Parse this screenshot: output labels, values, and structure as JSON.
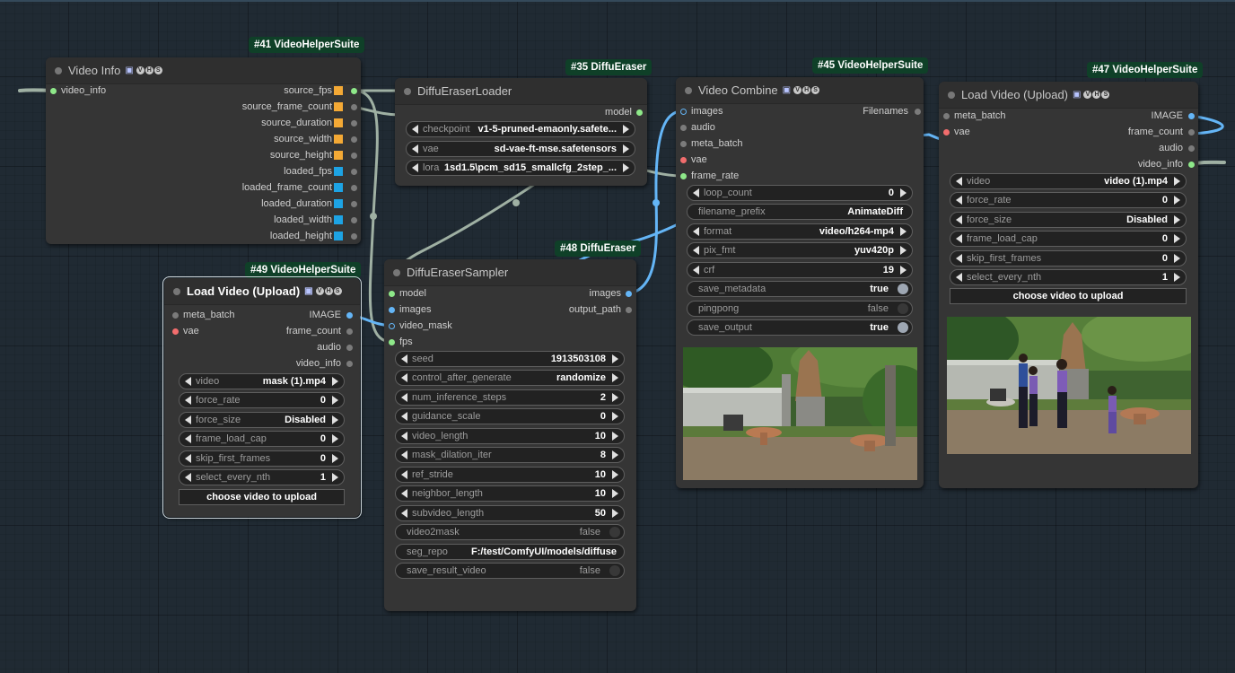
{
  "nodes": {
    "video_info": {
      "badge": "#41 VideoHelperSuite",
      "title": "Video Info",
      "inputs": [
        "video_info"
      ],
      "outputs": [
        "source_fps",
        "source_frame_count",
        "source_duration",
        "source_width",
        "source_height",
        "loaded_fps",
        "loaded_frame_count",
        "loaded_duration",
        "loaded_width",
        "loaded_height"
      ]
    },
    "loader": {
      "badge": "#35 DiffuEraser",
      "title": "DiffuEraserLoader",
      "output": "model",
      "widgets": [
        {
          "label": "checkpoint",
          "value": "v1-5-pruned-emaonly.safete..."
        },
        {
          "label": "vae",
          "value": "sd-vae-ft-mse.safetensors"
        },
        {
          "label": "lora",
          "value": "1sd1.5\\pcm_sd15_smallcfg_2step_..."
        }
      ]
    },
    "sampler": {
      "badge": "#48 DiffuEraser",
      "title": "DiffuEraserSampler",
      "inputs": [
        "model",
        "images",
        "video_mask",
        "fps"
      ],
      "outputs": [
        "images",
        "output_path"
      ],
      "widgets": [
        {
          "label": "seed",
          "value": "1913503108"
        },
        {
          "label": "control_after_generate",
          "value": "randomize"
        },
        {
          "label": "num_inference_steps",
          "value": "2"
        },
        {
          "label": "guidance_scale",
          "value": "0"
        },
        {
          "label": "video_length",
          "value": "10"
        },
        {
          "label": "mask_dilation_iter",
          "value": "8"
        },
        {
          "label": "ref_stride",
          "value": "10"
        },
        {
          "label": "neighbor_length",
          "value": "10"
        },
        {
          "label": "subvideo_length",
          "value": "50"
        }
      ],
      "toggle_video2mask": {
        "label": "video2mask",
        "value": "false"
      },
      "seg_repo": {
        "label": "seg_repo",
        "value": "F:/test/ComfyUI/models/diffuse"
      },
      "toggle_save_result": {
        "label": "save_result_video",
        "value": "false"
      }
    },
    "combine": {
      "badge": "#45 VideoHelperSuite",
      "title": "Video Combine",
      "inputs": [
        "images",
        "audio",
        "meta_batch",
        "vae",
        "frame_rate"
      ],
      "output": "Filenames",
      "loop_count": {
        "label": "loop_count",
        "value": "0"
      },
      "filename_prefix": {
        "label": "filename_prefix",
        "value": "AnimateDiff"
      },
      "format": {
        "label": "format",
        "value": "video/h264-mp4"
      },
      "pix_fmt": {
        "label": "pix_fmt",
        "value": "yuv420p"
      },
      "crf": {
        "label": "crf",
        "value": "19"
      },
      "save_metadata": {
        "label": "save_metadata",
        "value": "true"
      },
      "pingpong": {
        "label": "pingpong",
        "value": "false"
      },
      "save_output": {
        "label": "save_output",
        "value": "true"
      }
    },
    "load47": {
      "badge": "#47 VideoHelperSuite",
      "title": "Load Video (Upload)",
      "inputs": [
        "meta_batch",
        "vae"
      ],
      "outputs": [
        "IMAGE",
        "frame_count",
        "audio",
        "video_info"
      ],
      "widgets": [
        {
          "label": "video",
          "value": "video (1).mp4"
        },
        {
          "label": "force_rate",
          "value": "0"
        },
        {
          "label": "force_size",
          "value": "Disabled"
        },
        {
          "label": "frame_load_cap",
          "value": "0"
        },
        {
          "label": "skip_first_frames",
          "value": "0"
        },
        {
          "label": "select_every_nth",
          "value": "1"
        }
      ],
      "button": "choose video to upload"
    },
    "load49": {
      "badge": "#49 VideoHelperSuite",
      "title": "Load Video (Upload)",
      "inputs": [
        "meta_batch",
        "vae"
      ],
      "outputs": [
        "IMAGE",
        "frame_count",
        "audio",
        "video_info"
      ],
      "widgets": [
        {
          "label": "video",
          "value": "mask (1).mp4"
        },
        {
          "label": "force_rate",
          "value": "0"
        },
        {
          "label": "force_size",
          "value": "Disabled"
        },
        {
          "label": "frame_load_cap",
          "value": "0"
        },
        {
          "label": "skip_first_frames",
          "value": "0"
        },
        {
          "label": "select_every_nth",
          "value": "1"
        }
      ],
      "button": "choose video to upload"
    }
  },
  "colors": {
    "canvas": "#202a33",
    "node_body": "#353535",
    "node_title": "#2f2f2f",
    "badge": "#0f4028",
    "link_gray": "#9fb0a3",
    "link_blue": "#64b5f6",
    "slot_green": "#8ee889",
    "slot_blue": "#64b5f6",
    "slot_red": "#f26d6d",
    "slot_orange": "#f4a935",
    "slot_cyan": "#1da3e4"
  }
}
